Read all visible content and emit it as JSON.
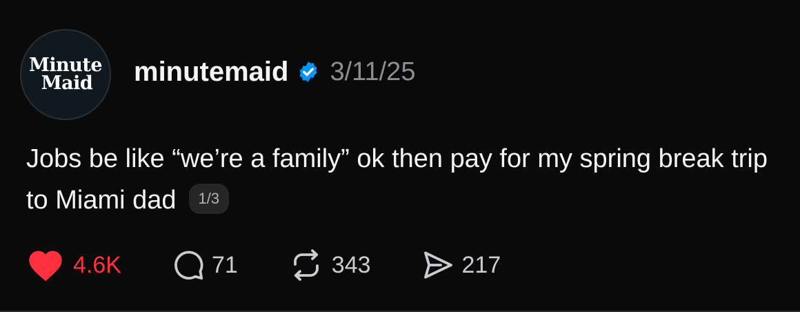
{
  "post": {
    "avatar": {
      "logo_line1": "Minute",
      "logo_line2": "Maid"
    },
    "username": "minutemaid",
    "verified_icon": "verified-badge-icon",
    "date": "3/11/25",
    "text": "Jobs be like “we’re a family” ok then pay for my spring break trip to Miami dad",
    "page_indicator": "1/3"
  },
  "actions": {
    "like": {
      "icon": "heart-filled-icon",
      "count": "4.6K",
      "color": "#ff3040"
    },
    "reply": {
      "icon": "comment-bubble-icon",
      "count": "71"
    },
    "repost": {
      "icon": "repost-icon",
      "count": "343"
    },
    "share": {
      "icon": "send-icon",
      "count": "217"
    }
  },
  "colors": {
    "background": "#0a0a0a",
    "text": "#f3f5f7",
    "muted": "#8b8f94",
    "verified": "#0095f6",
    "like": "#ff3040"
  }
}
